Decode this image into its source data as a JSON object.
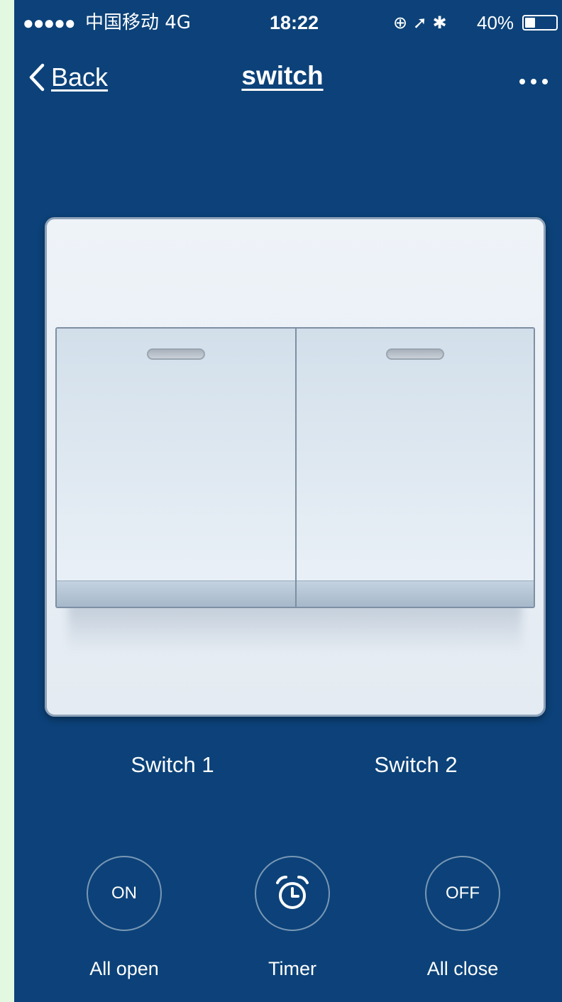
{
  "status_bar": {
    "signal": "●●●●●",
    "carrier": "中国移动  4G",
    "time": "18:22",
    "icons": "⊕ ➚ ✱",
    "battery_percent": "40%",
    "battery_level": 0.4
  },
  "nav": {
    "back_label": "Back",
    "title": "switch",
    "more_icon": "more-dots-icon"
  },
  "switches": [
    {
      "label": "Switch 1"
    },
    {
      "label": "Switch 2"
    }
  ],
  "actions": [
    {
      "circle_text": "ON",
      "caption": "All open",
      "icon": "on-icon"
    },
    {
      "circle_text": "",
      "caption": "Timer",
      "icon": "alarm-clock-icon"
    },
    {
      "circle_text": "OFF",
      "caption": "All close",
      "icon": "off-icon"
    }
  ],
  "colors": {
    "background": "#0c4279",
    "plate": "#e8eef5",
    "text": "#ffffff"
  }
}
